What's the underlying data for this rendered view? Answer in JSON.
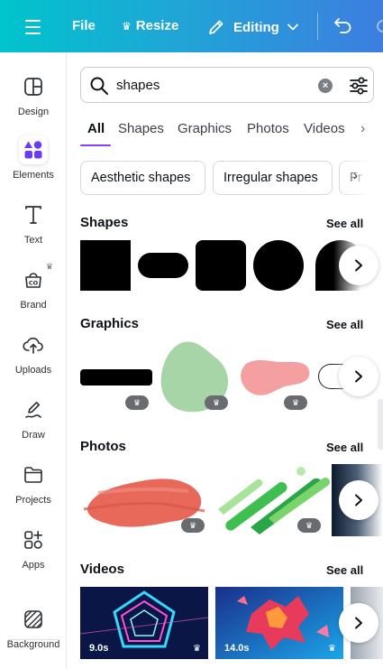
{
  "topbar": {
    "file": "File",
    "resize": "Resize",
    "editing": "Editing"
  },
  "rail": {
    "items": [
      {
        "label": "Design",
        "icon": "design-icon"
      },
      {
        "label": "Elements",
        "icon": "elements-icon"
      },
      {
        "label": "Text",
        "icon": "text-icon"
      },
      {
        "label": "Brand",
        "icon": "brand-icon"
      },
      {
        "label": "Uploads",
        "icon": "uploads-icon"
      },
      {
        "label": "Draw",
        "icon": "draw-icon"
      },
      {
        "label": "Projects",
        "icon": "projects-icon"
      },
      {
        "label": "Apps",
        "icon": "apps-icon"
      },
      {
        "label": "Background",
        "icon": "background-icon"
      }
    ],
    "active": "Elements"
  },
  "search": {
    "value": "shapes"
  },
  "tabs": [
    "All",
    "Shapes",
    "Graphics",
    "Photos",
    "Videos"
  ],
  "active_tab": "All",
  "chips": [
    "Aesthetic shapes",
    "Irregular shapes",
    "Fr"
  ],
  "sections": {
    "shapes": {
      "title": "Shapes",
      "see_all": "See all"
    },
    "graphics": {
      "title": "Graphics",
      "see_all": "See all"
    },
    "photos": {
      "title": "Photos",
      "see_all": "See all"
    },
    "videos": {
      "title": "Videos",
      "see_all": "See all"
    }
  },
  "videos": [
    {
      "duration": "9.0s"
    },
    {
      "duration": "14.0s"
    }
  ],
  "colors": {
    "accent": "#8b3dff",
    "topbar_start": "#00c4cc",
    "topbar_end": "#3d7ee0",
    "graphic_green": "#a8d5a8",
    "graphic_pink": "#f4a0a0",
    "photo_red": "#e8685a",
    "photo_green": "#3fbf4f"
  }
}
